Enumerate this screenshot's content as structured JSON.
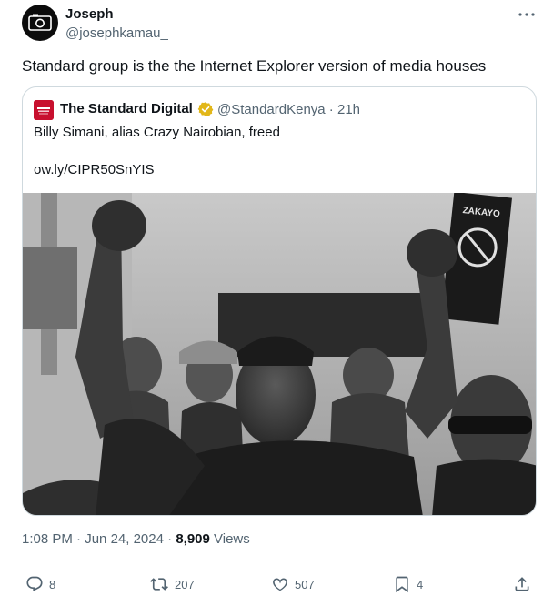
{
  "author": {
    "display_name": "Joseph",
    "handle": "@josephkamau_"
  },
  "tweet_text": "Standard group is the the Internet Explorer version of media houses",
  "quoted": {
    "display_name": "The Standard Digital",
    "handle": "@StandardKenya",
    "separator": " · ",
    "time_ago": "21h",
    "text": "Billy Simani, alias Crazy Nairobian, freed",
    "link": "ow.ly/CIPR50SnYIS",
    "photo": {
      "sign_text": "ZAKAYO",
      "style": "black-and-white protest photo"
    }
  },
  "meta": {
    "time": "1:08 PM",
    "separator": " · ",
    "date": "Jun 24, 2024",
    "separator2": " · ",
    "views_count": "8,909",
    "views_label": " Views"
  },
  "actions": {
    "replies": "8",
    "retweets": "207",
    "likes": "507",
    "bookmarks": "4"
  },
  "colors": {
    "text": "#0f1419",
    "secondary": "#536471",
    "border": "#cfd9de",
    "badge_gold": "#e2b719",
    "standard_red": "#c8102e"
  }
}
